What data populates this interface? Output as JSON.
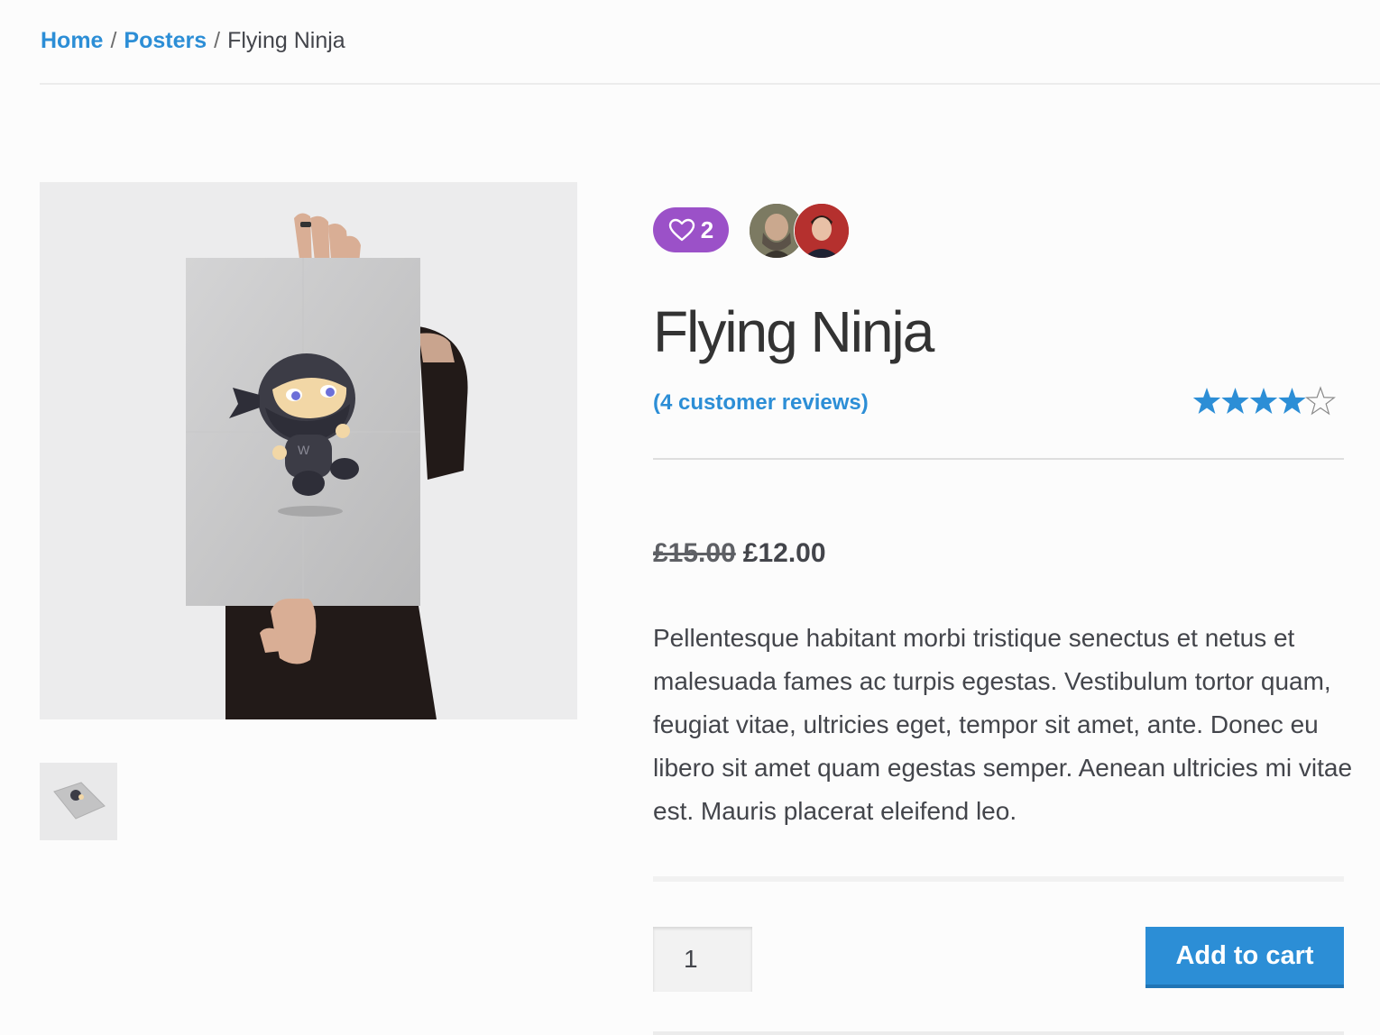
{
  "breadcrumb": {
    "home": "Home",
    "separator": "/",
    "category": "Posters",
    "current": "Flying Ninja"
  },
  "gallery": {
    "main_image_alt": "Flying Ninja poster",
    "thumbnail_alt": "Flying Ninja poster thumbnail"
  },
  "likes": {
    "count": "2",
    "icon": "heart-outline-icon",
    "color": "#9b51c8"
  },
  "product": {
    "title": "Flying Ninja",
    "reviews_link": "(4 customer reviews)",
    "rating": 4,
    "rating_max": 5,
    "price_old": "£15.00",
    "price_new": "£12.00",
    "description": "Pellentesque habitant morbi tristique senectus et netus et malesuada fames ac turpis egestas. Vestibulum tortor quam, feugiat vitae, ultricies eget, tempor sit amet, ante. Donec eu libero sit amet quam egestas semper. Aenean ultricies mi vitae est. Mauris placerat eleifend leo."
  },
  "cart": {
    "quantity": "1",
    "button_label": "Add to cart"
  },
  "colors": {
    "accent": "#2c8ed6",
    "like_badge": "#9b51c8",
    "star": "#2c8ed6"
  }
}
